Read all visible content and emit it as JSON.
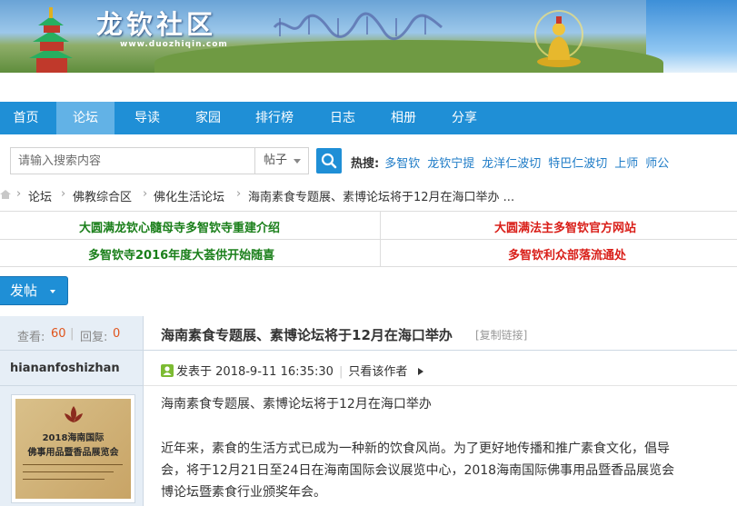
{
  "banner": {
    "logo_text": "龙钦社区",
    "logo_url": "www.duozhiqin.com"
  },
  "nav": {
    "items": [
      "首页",
      "论坛",
      "导读",
      "家园",
      "排行榜",
      "日志",
      "相册",
      "分享"
    ],
    "active": "论坛"
  },
  "search": {
    "placeholder": "请输入搜索内容",
    "type_label": "帖子",
    "hot_label": "热搜:",
    "hot_links": [
      "多智钦",
      "龙钦宁提",
      "龙洋仁波切",
      "特巴仁波切",
      "上师",
      "师公"
    ]
  },
  "breadcrumb": [
    "论坛",
    "佛教综合区",
    "佛化生活论坛",
    "海南素食专题展、素博论坛将于12月在海口举办 ..."
  ],
  "announcements": [
    {
      "text": "大圆满龙钦心髓母寺多智钦寺重建介绍",
      "color": "#1a7f1a"
    },
    {
      "text": "大圆满法主多智钦官方网站",
      "color": "#d91e18"
    },
    {
      "text": "多智钦寺2016年度大荟供开始随喜",
      "color": "#1a7f1a"
    },
    {
      "text": "多智钦利众部落流通处",
      "color": "#d91e18"
    }
  ],
  "post_button": "发帖",
  "stats": {
    "views_label": "查看:",
    "views": "60",
    "replies_label": "回复:",
    "replies": "0"
  },
  "thread": {
    "title": "海南素食专题展、素博论坛将于12月在海口举办",
    "copy_link": "[复制链接]",
    "author": "hiananfoshizhan",
    "posted_label": "发表于",
    "posted_time": "2018-9-11 16:35:30",
    "only_author": "只看该作者",
    "body": [
      "海南素食专题展、素博论坛将于12月在海口举办",
      "近年来，素食的生活方式已成为一种新的饮食风尚。为了更好地传播和推广素食文化，倡导",
      "会，将于12月21日至24日在海南国际会议展览中心，2018海南国际佛事用品暨香品展览会",
      "博论坛暨素食行业颁奖年会。"
    ]
  },
  "avatar": {
    "line1": "2018海南国际",
    "line2": "佛事用品暨香品展览会"
  },
  "colors": {
    "nav_bg": "#1f8fd6",
    "nav_active": "#62b2e6",
    "link": "#1f7cc7",
    "stat_value": "#e0541c"
  }
}
